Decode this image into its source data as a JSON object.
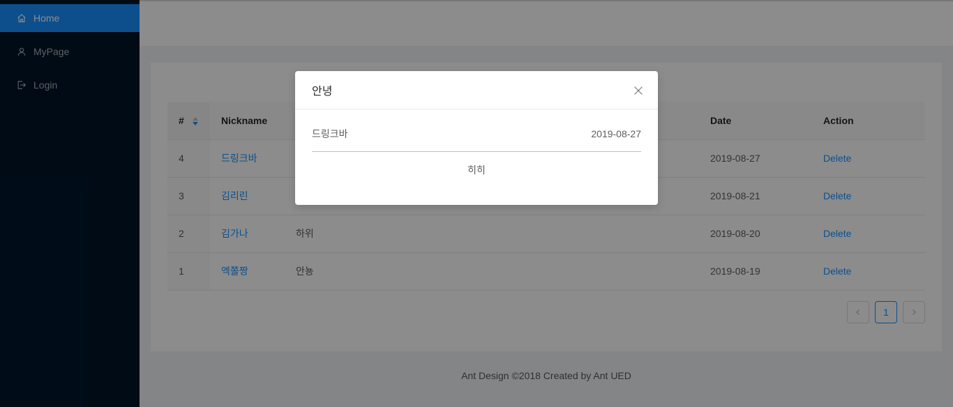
{
  "sidebar": {
    "items": [
      {
        "label": "Home",
        "icon": "home-icon",
        "active": true
      },
      {
        "label": "MyPage",
        "icon": "user-icon",
        "active": false
      },
      {
        "label": "Login",
        "icon": "login-icon",
        "active": false
      }
    ]
  },
  "table": {
    "columns": [
      "#",
      "Nickname",
      "Date",
      "Action"
    ],
    "rows": [
      {
        "id": "4",
        "nickname": "드링크바",
        "content": "",
        "date": "2019-08-27",
        "action": "Delete"
      },
      {
        "id": "3",
        "nickname": "김리린",
        "content": "",
        "date": "2019-08-21",
        "action": "Delete"
      },
      {
        "id": "2",
        "nickname": "김가나",
        "content": "하위",
        "date": "2019-08-20",
        "action": "Delete"
      },
      {
        "id": "1",
        "nickname": "엑쫄짱",
        "content": "안뇽",
        "date": "2019-08-19",
        "action": "Delete"
      }
    ]
  },
  "pagination": {
    "current": "1",
    "prev_icon": "chevron-left-icon",
    "next_icon": "chevron-right-icon"
  },
  "footer": {
    "text": "Ant Design ©2018 Created by Ant UED"
  },
  "modal": {
    "title": "안녕",
    "name": "드링크바",
    "date": "2019-08-27",
    "content": "히히",
    "close_icon": "close-icon"
  },
  "colors": {
    "sider_bg": "#001529",
    "primary": "#1890ff"
  }
}
